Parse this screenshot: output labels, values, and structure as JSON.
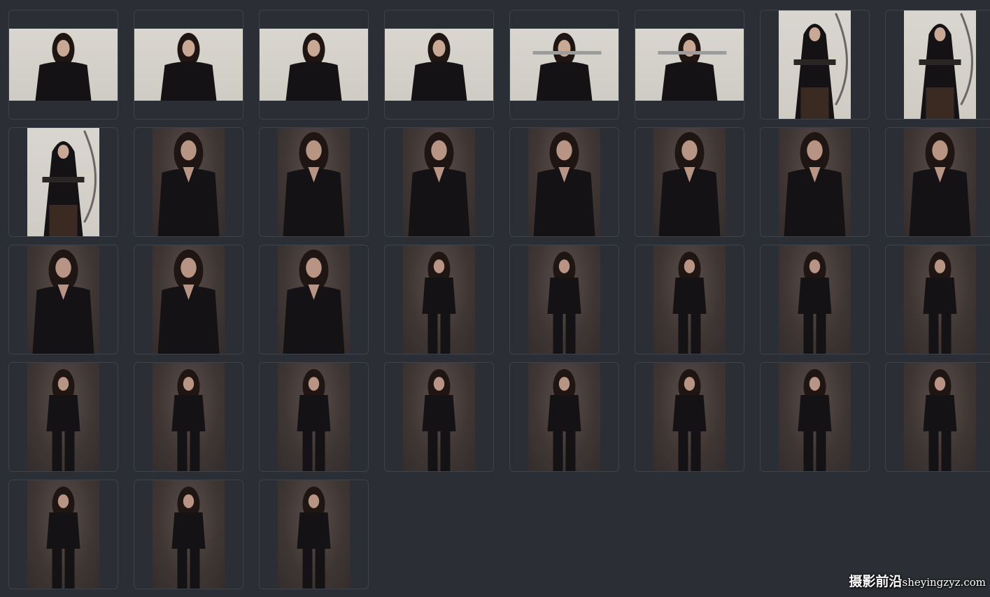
{
  "gallery": {
    "rows": 5,
    "columns": 8,
    "items": [
      {
        "orientation": "landscape",
        "backdrop": "light",
        "subject": "woman-black-leather-outfit"
      },
      {
        "orientation": "landscape",
        "backdrop": "light",
        "subject": "woman-black-leather-outfit"
      },
      {
        "orientation": "landscape",
        "backdrop": "light",
        "subject": "woman-black-leather-outfit"
      },
      {
        "orientation": "landscape",
        "backdrop": "light",
        "subject": "woman-black-leather-outfit"
      },
      {
        "orientation": "landscape",
        "backdrop": "light",
        "subject": "woman-holding-sword"
      },
      {
        "orientation": "landscape",
        "backdrop": "light",
        "subject": "woman-holding-sword"
      },
      {
        "orientation": "portrait",
        "backdrop": "light",
        "subject": "hooded-archer"
      },
      {
        "orientation": "portrait",
        "backdrop": "light",
        "subject": "hooded-archer"
      },
      {
        "orientation": "portrait",
        "backdrop": "light",
        "subject": "hooded-archer"
      },
      {
        "orientation": "portrait",
        "backdrop": "dark",
        "subject": "woman-black-blouse"
      },
      {
        "orientation": "portrait",
        "backdrop": "dark",
        "subject": "woman-black-blouse"
      },
      {
        "orientation": "portrait",
        "backdrop": "dark",
        "subject": "woman-black-blouse"
      },
      {
        "orientation": "portrait",
        "backdrop": "dark",
        "subject": "woman-black-blouse"
      },
      {
        "orientation": "portrait",
        "backdrop": "dark",
        "subject": "woman-black-blouse"
      },
      {
        "orientation": "portrait",
        "backdrop": "dark",
        "subject": "woman-black-blouse"
      },
      {
        "orientation": "portrait",
        "backdrop": "dark",
        "subject": "woman-black-blouse"
      },
      {
        "orientation": "portrait",
        "backdrop": "dark",
        "subject": "woman-black-blouse"
      },
      {
        "orientation": "portrait",
        "backdrop": "dark",
        "subject": "woman-black-blouse"
      },
      {
        "orientation": "portrait",
        "backdrop": "dark",
        "subject": "woman-black-blouse"
      },
      {
        "orientation": "portrait",
        "backdrop": "dark",
        "subject": "woman-black-outfit-standing"
      },
      {
        "orientation": "portrait",
        "backdrop": "dark",
        "subject": "woman-black-outfit-standing"
      },
      {
        "orientation": "portrait",
        "backdrop": "dark",
        "subject": "woman-black-outfit-standing"
      },
      {
        "orientation": "portrait",
        "backdrop": "dark",
        "subject": "woman-black-outfit-standing"
      },
      {
        "orientation": "portrait",
        "backdrop": "dark",
        "subject": "woman-black-outfit-standing"
      },
      {
        "orientation": "portrait",
        "backdrop": "dark",
        "subject": "woman-black-outfit-standing"
      },
      {
        "orientation": "portrait",
        "backdrop": "dark",
        "subject": "woman-black-outfit-standing"
      },
      {
        "orientation": "portrait",
        "backdrop": "dark",
        "subject": "woman-black-outfit-standing"
      },
      {
        "orientation": "portrait",
        "backdrop": "dark",
        "subject": "woman-black-outfit-standing"
      },
      {
        "orientation": "portrait",
        "backdrop": "dark",
        "subject": "woman-black-outfit-standing"
      },
      {
        "orientation": "portrait",
        "backdrop": "dark",
        "subject": "woman-black-outfit-standing"
      },
      {
        "orientation": "portrait",
        "backdrop": "dark",
        "subject": "woman-black-outfit-standing"
      },
      {
        "orientation": "portrait",
        "backdrop": "dark",
        "subject": "woman-black-outfit-standing"
      },
      {
        "orientation": "portrait",
        "backdrop": "dark",
        "subject": "woman-black-outfit-standing"
      },
      {
        "orientation": "portrait",
        "backdrop": "dark",
        "subject": "woman-black-outfit-standing"
      },
      {
        "orientation": "portrait",
        "backdrop": "dark",
        "subject": "woman-black-outfit-standing"
      }
    ]
  },
  "watermark": {
    "text": "摄影前沿",
    "domain": "sheyingzyz.com"
  },
  "colors": {
    "page_background": "#2b2e34",
    "cell_border": "#3e434b",
    "light_backdrop": "#d6d3cc",
    "dark_backdrop": "#4a403e"
  }
}
